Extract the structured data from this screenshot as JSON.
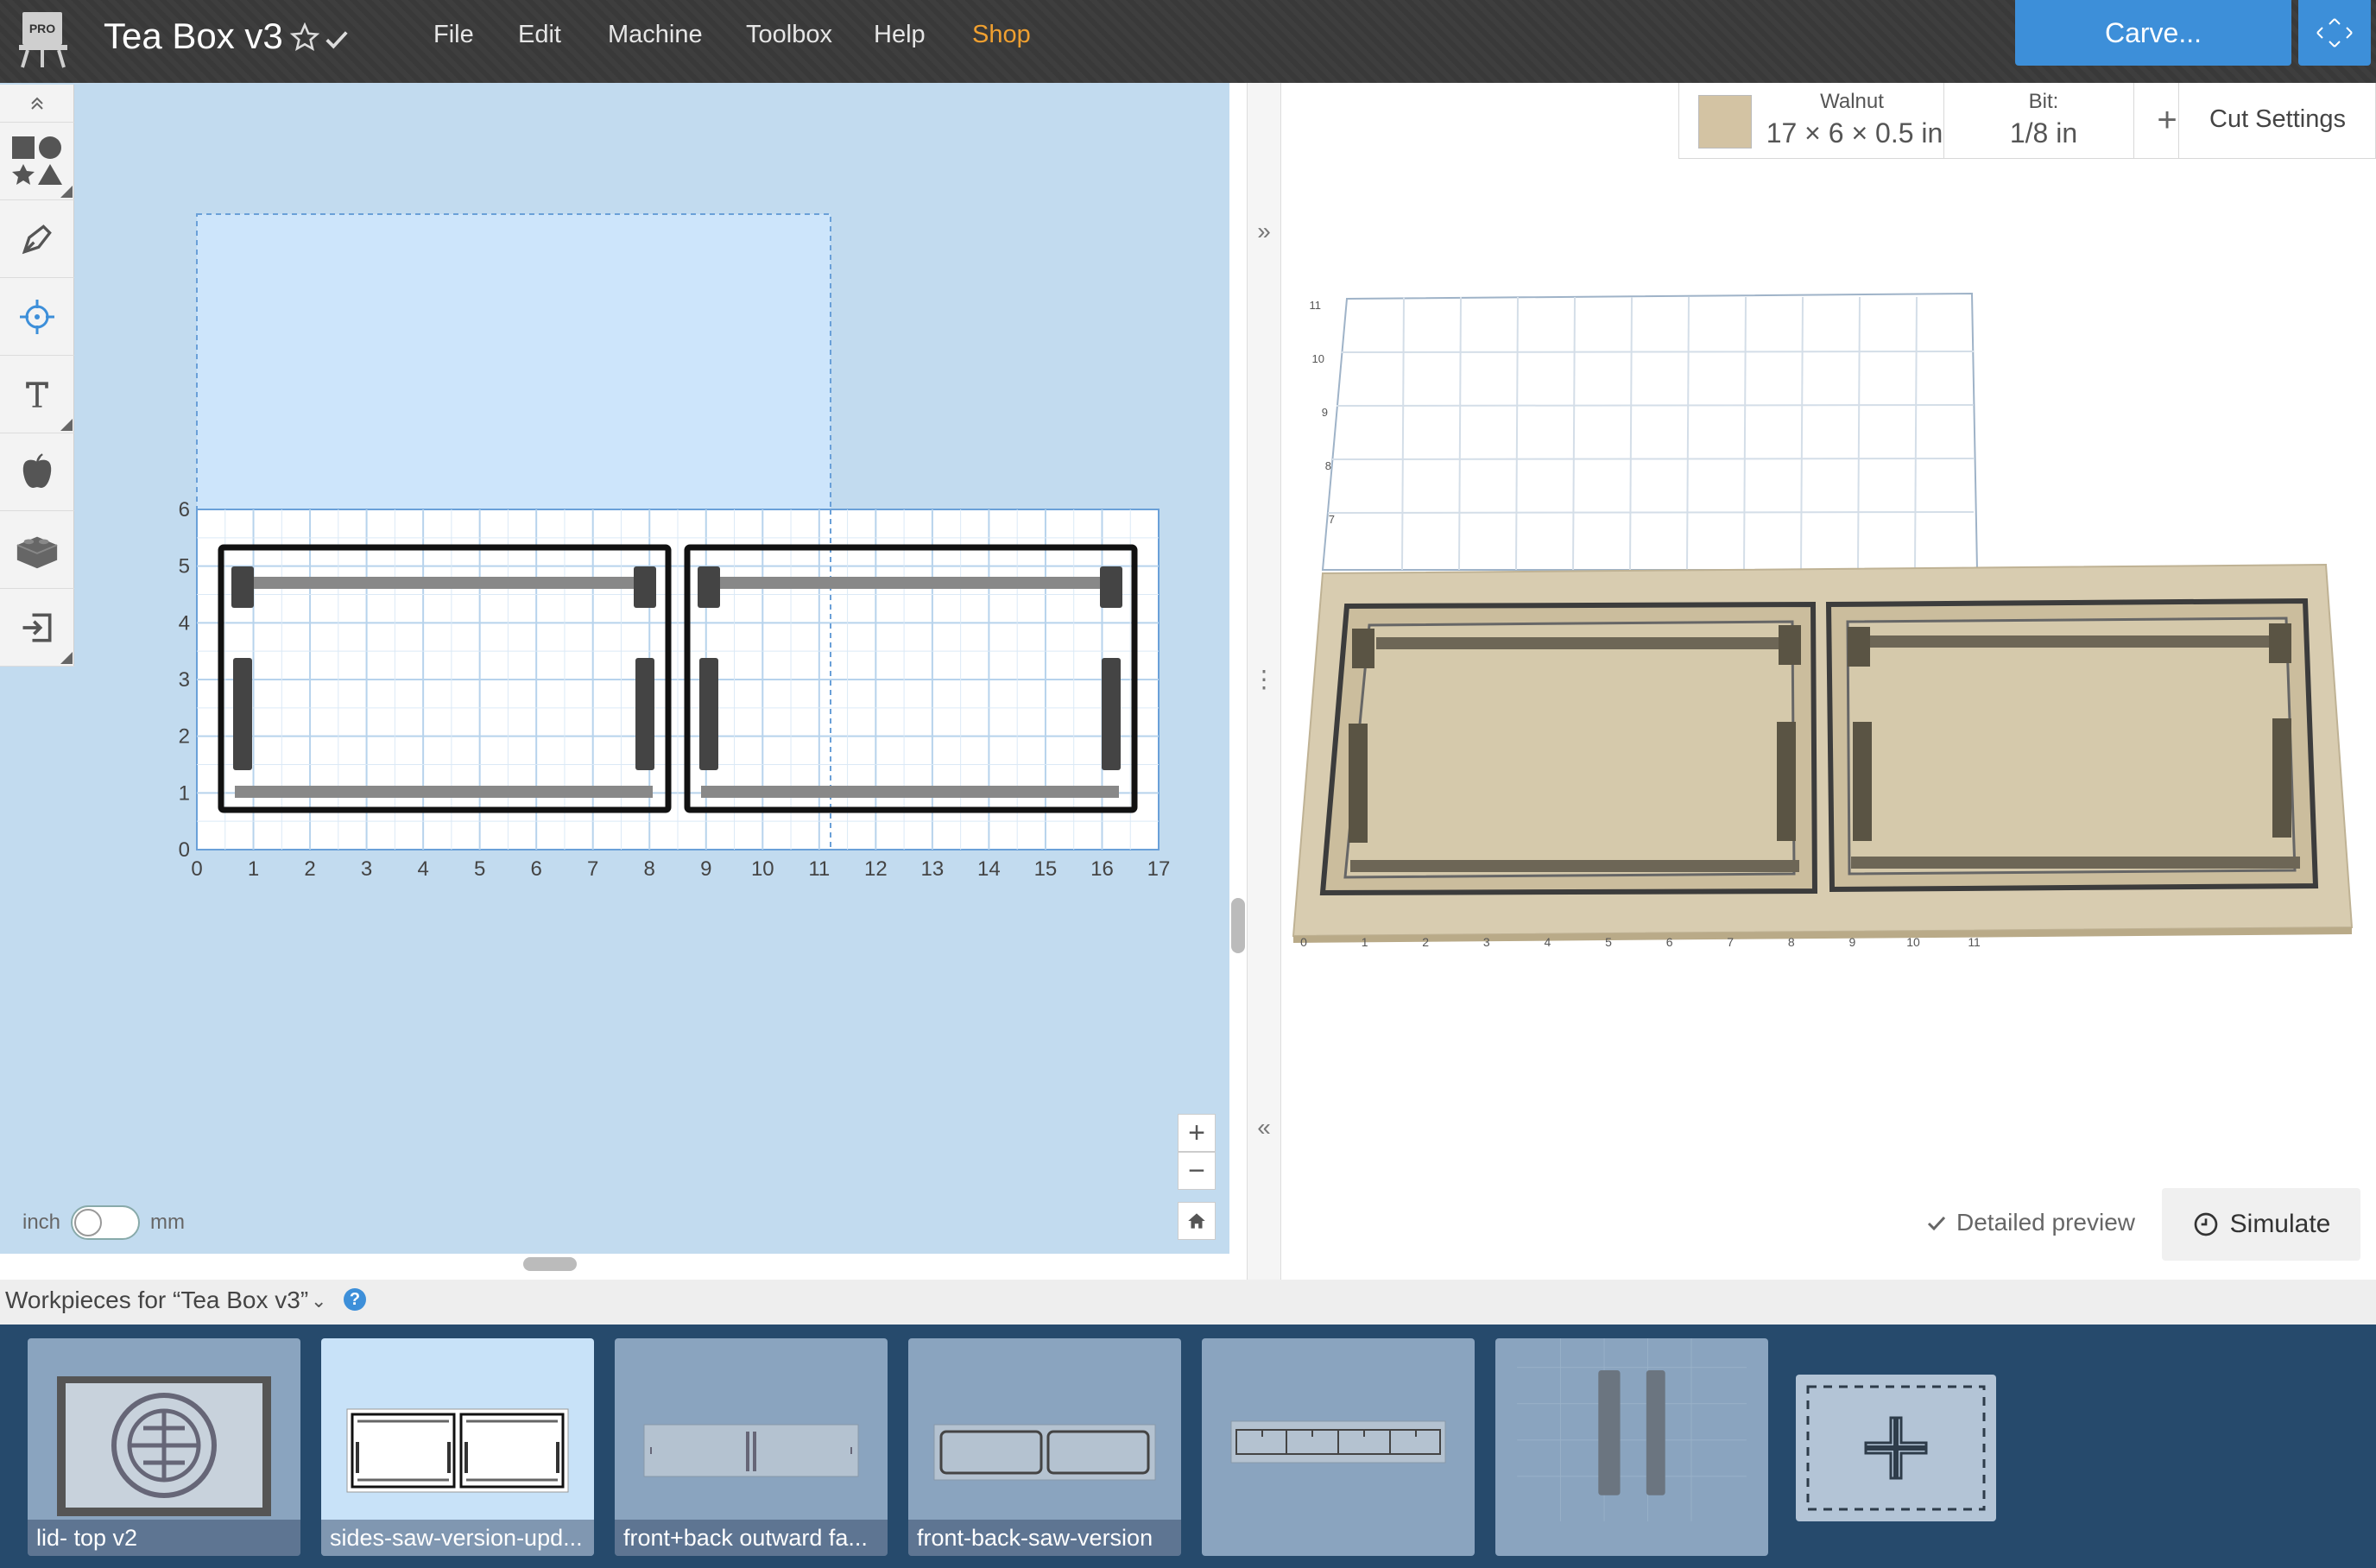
{
  "app": {
    "logo_badge": "PRO",
    "title": "Tea Box v3"
  },
  "menu": {
    "file": "File",
    "edit": "Edit",
    "machine": "Machine",
    "toolbox": "Toolbox",
    "help": "Help",
    "shop": "Shop"
  },
  "actions": {
    "carve": "Carve..."
  },
  "material": {
    "name": "Walnut",
    "dimensions": "17 × 6 × 0.5 in",
    "bit_label": "Bit:",
    "bit_value": "1/8 in",
    "add": "+",
    "cut_settings": "Cut Settings",
    "swatch_color": "#d3c3a3"
  },
  "canvas": {
    "units_left": "inch",
    "units_right": "mm",
    "x_ticks": [
      "0",
      "1",
      "2",
      "3",
      "4",
      "5",
      "6",
      "7",
      "8",
      "9",
      "10",
      "11",
      "12",
      "13",
      "14",
      "15",
      "16",
      "17"
    ],
    "y_ticks": [
      "0",
      "1",
      "2",
      "3",
      "4",
      "5",
      "6"
    ],
    "zoom_in": "+",
    "zoom_out": "−"
  },
  "preview": {
    "x_ticks": [
      "0",
      "1",
      "2",
      "3",
      "4",
      "5",
      "6",
      "7",
      "8",
      "9",
      "10",
      "11"
    ],
    "y_ticks": [
      "7",
      "8",
      "9",
      "10",
      "11"
    ],
    "detailed_preview": "Detailed preview",
    "simulate": "Simulate"
  },
  "workpieces": {
    "title": "Workpieces for “Tea Box v3”",
    "help": "?",
    "items": [
      {
        "label": "lid- top v2"
      },
      {
        "label": "sides-saw-version-upd..."
      },
      {
        "label": "front+back outward fa..."
      },
      {
        "label": "front-back-saw-version"
      },
      {
        "label": ""
      },
      {
        "label": ""
      }
    ]
  }
}
